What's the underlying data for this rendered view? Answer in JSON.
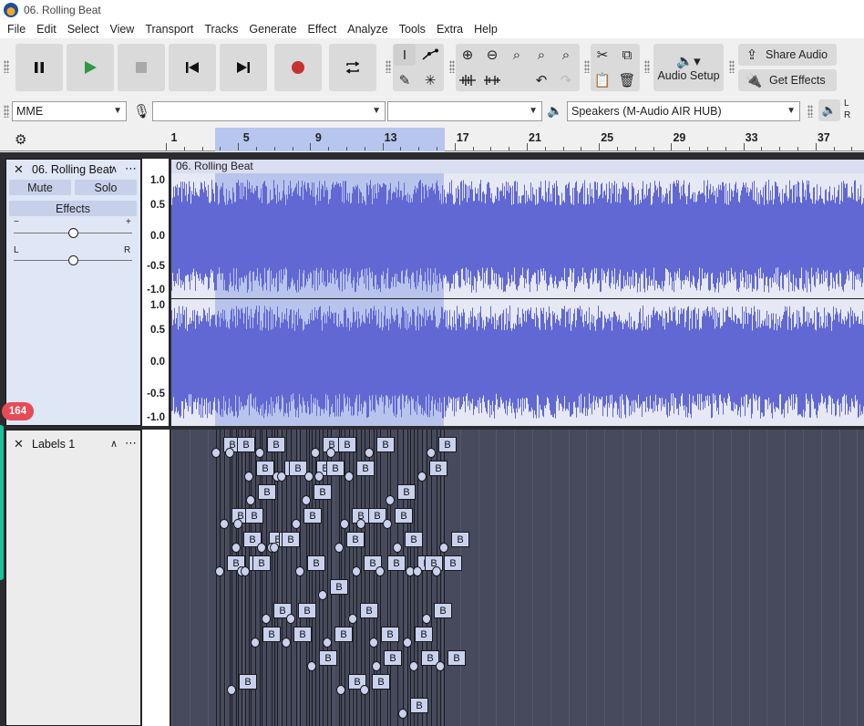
{
  "window": {
    "title": "06. Rolling Beat"
  },
  "menu": [
    "File",
    "Edit",
    "Select",
    "View",
    "Transport",
    "Tracks",
    "Generate",
    "Effect",
    "Analyze",
    "Tools",
    "Extra",
    "Help"
  ],
  "toolbar": {
    "audio_setup_label": "Audio Setup",
    "share_audio_label": "Share Audio",
    "get_effects_label": "Get Effects"
  },
  "devices": {
    "host": "MME",
    "recording_device": "",
    "recording_channels": "",
    "playback_device": "Speakers (M-Audio AIR HUB)"
  },
  "ruler": {
    "ticks": [
      "1",
      "5",
      "9",
      "13",
      "17",
      "21",
      "25",
      "29",
      "33",
      "37"
    ]
  },
  "meter_letters": [
    "L",
    "R"
  ],
  "audio_track": {
    "name": "06. Rolling Beat",
    "mute_label": "Mute",
    "solo_label": "Solo",
    "effects_label": "Effects",
    "gain_min": "−",
    "gain_max": "+",
    "pan_left": "L",
    "pan_right": "R",
    "clip_name": "06. Rolling Beat",
    "scale": [
      "1.0",
      "0.5",
      "0.0",
      "-0.5",
      "-1.0"
    ]
  },
  "label_track": {
    "name": "Labels 1",
    "label_text": "B"
  },
  "badge": {
    "count": "164"
  },
  "colors": {
    "waveform": "#6168d4",
    "selection": "#b6c6ee",
    "badge": "#e84a55",
    "accent": "#19c29b"
  }
}
